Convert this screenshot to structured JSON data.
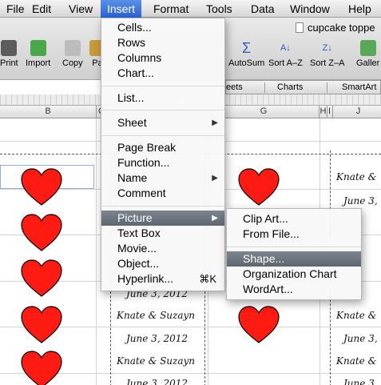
{
  "menubar": {
    "items": [
      "File",
      "Edit",
      "View",
      "Insert",
      "Format",
      "Tools",
      "Data",
      "Window",
      "Help"
    ],
    "active": "Insert"
  },
  "toolbar": {
    "doc_title": "cupcake toppe",
    "buttons": [
      "Print",
      "Import",
      "Copy",
      "Pa",
      "AutoSum",
      "Sort A–Z",
      "Sort Z–A",
      "Galler"
    ],
    "ribbon_tabs": [
      "eets",
      "Charts",
      "SmartArt"
    ]
  },
  "columns": [
    "B",
    "C",
    "G",
    "H",
    "I",
    "J"
  ],
  "sheet": {
    "names": "Knate & Suzayn",
    "names_short": "Knate &",
    "date": "June 3, 2012",
    "date_short": "June 3,",
    "date_partial": "2012"
  },
  "insert_menu": {
    "items": [
      {
        "label": "Cells..."
      },
      {
        "label": "Rows"
      },
      {
        "label": "Columns"
      },
      {
        "label": "Chart..."
      },
      {
        "label": "List..."
      },
      {
        "label": "Sheet",
        "submenu": true
      },
      {
        "label": "Page Break"
      },
      {
        "label": "Function..."
      },
      {
        "label": "Name",
        "submenu": true
      },
      {
        "label": "Comment"
      },
      {
        "label": "Picture",
        "submenu": true,
        "highlighted": true
      },
      {
        "label": "Text Box"
      },
      {
        "label": "Movie..."
      },
      {
        "label": "Object..."
      },
      {
        "label": "Hyperlink...",
        "shortcut": "⌘K"
      }
    ]
  },
  "picture_submenu": {
    "items": [
      {
        "label": "Clip Art..."
      },
      {
        "label": "From File..."
      },
      {
        "label": "Shape...",
        "highlighted": true
      },
      {
        "label": "Organization Chart"
      },
      {
        "label": "WordArt..."
      }
    ]
  },
  "colors": {
    "menu_highlight": "#626a74",
    "menubar_active": "#2a63d8",
    "heart": "#ff1a12"
  }
}
